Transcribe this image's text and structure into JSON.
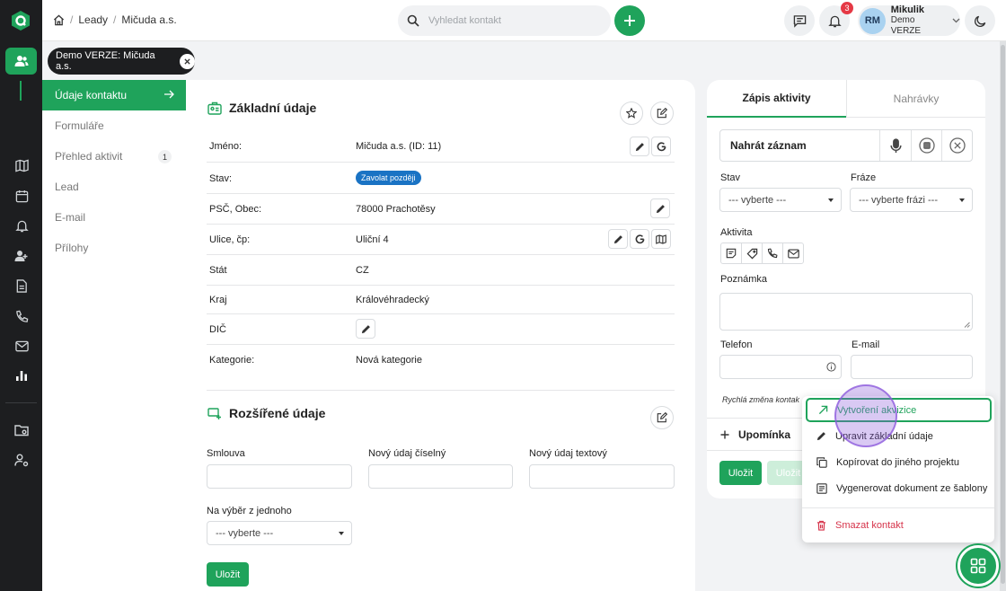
{
  "colors": {
    "accent": "#1fa35b",
    "status_pill": "#1a73c4",
    "danger": "#d6334a",
    "notification_badge": "#e53945"
  },
  "rail": {
    "icons": [
      "app-logo-icon",
      "users-icon",
      "map-icon",
      "calendar-icon",
      "bell-icon",
      "contact-icon",
      "document-icon",
      "phone-icon",
      "mail-icon",
      "chart-icon",
      "folder-icon",
      "user-settings-icon"
    ]
  },
  "breadcrumb": {
    "items": [
      "Leady",
      "Mičuda a.s."
    ]
  },
  "search": {
    "placeholder": "Vyhledat kontakt"
  },
  "notifications": {
    "count": "3"
  },
  "user": {
    "initials": "RM",
    "name": "Mikulik",
    "subtitle": "Demo VERZE"
  },
  "context_chip": {
    "label": "Demo VERZE: Mičuda a.s."
  },
  "subnav": {
    "items": [
      {
        "label": "Údaje kontaktu"
      },
      {
        "label": "Formuláře"
      },
      {
        "label": "Přehled aktivit",
        "count": "1"
      },
      {
        "label": "Lead"
      },
      {
        "label": "E-mail"
      },
      {
        "label": "Přílohy"
      }
    ]
  },
  "basic": {
    "title": "Základní údaje",
    "rows": [
      {
        "label": "Jméno:",
        "value": "Mičuda a.s. (ID: 11)"
      },
      {
        "label": "Stav:",
        "value": "Zavolat později"
      },
      {
        "label": "PSČ, Obec:",
        "value": "78000 Prachotěsy"
      },
      {
        "label": "Ulice, čp:",
        "value": "Uliční 4"
      },
      {
        "label": "Stát",
        "value": "CZ"
      },
      {
        "label": "Kraj",
        "value": "Královéhradecký"
      },
      {
        "label": "DIČ",
        "value": ""
      },
      {
        "label": "Kategorie:",
        "value": "Nová kategorie"
      }
    ]
  },
  "extended": {
    "title": "Rozšířené údaje",
    "fields": [
      "Smlouva",
      "Nový údaj číselný",
      "Nový údaj textový"
    ],
    "select_label": "Na výběr z jednoho",
    "select_value": "--- vyberte ---",
    "save_label": "Uložit"
  },
  "activity": {
    "tabs": [
      "Zápis aktivity",
      "Nahrávky"
    ],
    "record_label": "Nahrát záznam",
    "stav_label": "Stav",
    "stav_value": "--- vyberte ---",
    "fraze_label": "Fráze",
    "fraze_value": "--- vyberte frázi ---",
    "aktivita_label": "Aktivita",
    "poznamka_label": "Poznámka",
    "telefon_label": "Telefon",
    "email_label": "E-mail",
    "quick_change": "Rychlá změna kontak",
    "upominka_label": "Upomínka",
    "save_label": "Uložit",
    "save2_label": "Uložit"
  },
  "context_menu": {
    "items": [
      {
        "label": "Vytvoření akvizice",
        "icon": "arrow-up-right-icon"
      },
      {
        "label": "Upravit základní údaje",
        "icon": "pencil-icon"
      },
      {
        "label": "Kopírovat do jiného projektu",
        "icon": "copy-icon"
      },
      {
        "label": "Vygenerovat dokument ze šablony",
        "icon": "document-template-icon"
      },
      {
        "label": "Smazat kontakt",
        "icon": "trash-icon"
      }
    ]
  }
}
